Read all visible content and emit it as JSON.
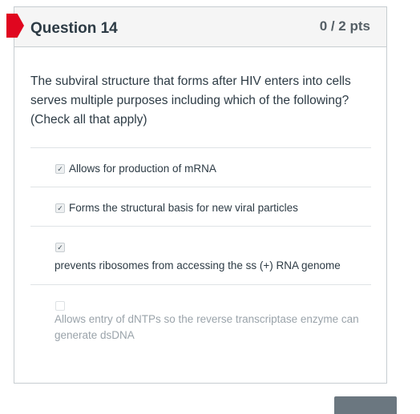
{
  "question": {
    "title": "Question 14",
    "points": "0 / 2 pts",
    "prompt": "The subviral structure that forms after HIV enters into cells serves multiple purposes including which of the following? (Check all that apply)",
    "answers": [
      {
        "label": "Allows for production of mRNA",
        "checked": true,
        "check_glyph": "✓"
      },
      {
        "label": "Forms the structural basis for new viral particles",
        "checked": true,
        "check_glyph": "✓"
      },
      {
        "label": "prevents ribosomes from accessing the ss (+) RNA genome",
        "checked": true,
        "check_glyph": "✓"
      },
      {
        "label": "Allows entry of dNTPs so the reverse transcriptase enzyme can generate dsDNA",
        "checked": false,
        "check_glyph": ""
      }
    ]
  },
  "colors": {
    "flag": "#e0061f",
    "header_bg": "#f5f5f5",
    "text": "#2d3b45",
    "muted_text": "#9aa3aa",
    "border": "#c7cdd1"
  },
  "icons": {
    "flag": "flag-icon",
    "check": "checkmark-icon"
  }
}
